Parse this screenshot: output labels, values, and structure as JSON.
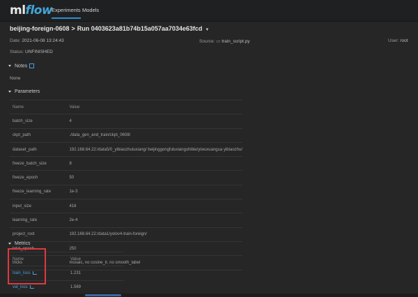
{
  "app": {
    "logo_ml": "ml",
    "logo_flow": "flow",
    "nav": [
      "Experiments",
      "Models"
    ]
  },
  "breadcrumb": {
    "experiment": "beijing-foreign-0608",
    "separator": ">",
    "run": "Run 0403623a81b74b15a057aa7034e63fcd"
  },
  "meta": {
    "date_label": "Date:",
    "date_value": "2021-06-08 13:24:43",
    "source_label": "Source:",
    "source_value": "train_script.py",
    "user_label": "User:",
    "user_value": "root",
    "status_label": "Status:",
    "status_value": "UNFINISHED"
  },
  "notes": {
    "title": "Notes",
    "body": "None"
  },
  "parameters": {
    "title": "Parameters",
    "headers": [
      "Name",
      "Value"
    ],
    "rows": [
      [
        "batch_size",
        "4"
      ],
      [
        "ckpt_path",
        "./data_gen_and_train/ckpt_0608/"
      ],
      [
        "dataset_path",
        "192.168.64.22:/data5/0_yibiaozhuiuxiang/ beijinggongfuluxiangshibie/yiwuxuangua yibiaozhu/"
      ],
      [
        "freeze_batch_size",
        "8"
      ],
      [
        "freeze_epoch",
        "50"
      ],
      [
        "freeze_learning_rate",
        "1e-3"
      ],
      [
        "input_size",
        "416"
      ],
      [
        "learning_rate",
        "2e-4"
      ],
      [
        "project_root",
        "192.168.64.22:/data1/yolov4-train-foreign/"
      ],
      [
        "total_epoch",
        "250"
      ],
      [
        "tricks",
        "mosaic, no cosine_lr, no smooth_label"
      ]
    ]
  },
  "metrics": {
    "title": "Metrics",
    "headers": [
      "Name",
      "Value"
    ],
    "rows": [
      [
        "train_loss",
        "1.231"
      ],
      [
        "val_loss",
        "1.569"
      ]
    ]
  },
  "colors": {
    "accent": "#43a5d8",
    "highlight_box": "#e0393e",
    "background": "#262626"
  }
}
